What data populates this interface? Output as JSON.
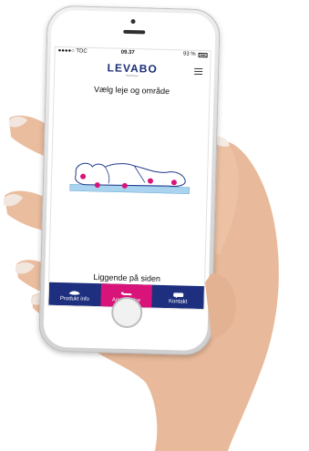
{
  "status": {
    "carrier": "●●●●○ TDC",
    "time": "09.37",
    "battery": "93 %"
  },
  "brand": {
    "logo": "LEVABO",
    "tagline": "Healthcare",
    "color": "#1b2f78"
  },
  "page": {
    "heading": "Vælg leje og område",
    "caption": "Liggende på siden"
  },
  "tabs": [
    {
      "label": "Produkt info",
      "icon": "pillow-icon",
      "active": false
    },
    {
      "label": "Anvendelse",
      "icon": "lying-person-icon",
      "active": true
    },
    {
      "label": "Kontakt",
      "icon": "chat-bubble-icon",
      "active": false
    }
  ],
  "colors": {
    "nav_bar": "#1d2f7e",
    "active_tab": "#d8137a",
    "pressure_point": "#d8137a",
    "mattress": "#a9d3ef"
  }
}
